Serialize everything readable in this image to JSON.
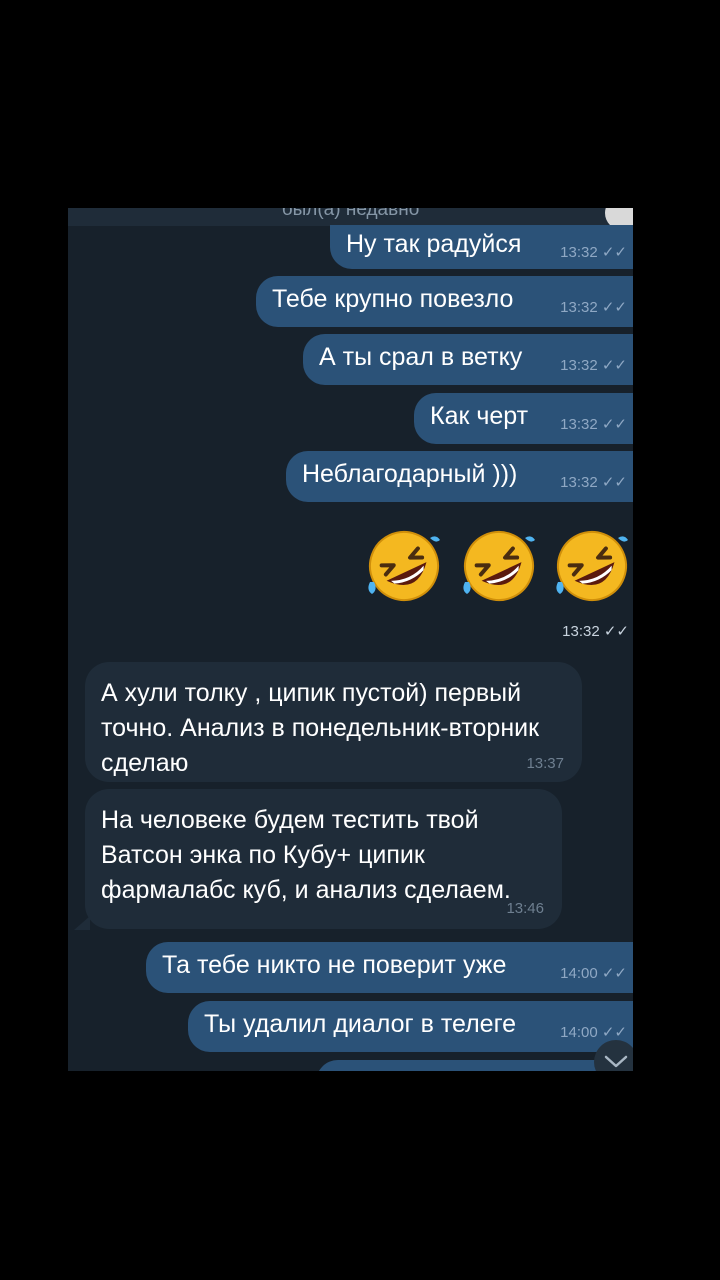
{
  "header": {
    "status": "был(а) недавно"
  },
  "messages_out_top": [
    {
      "text": "Ну так радуйся",
      "time": "13:32"
    },
    {
      "text": "Тебе крупно повезло",
      "time": "13:32"
    },
    {
      "text": "А ты срал в ветку",
      "time": "13:32"
    },
    {
      "text": "Как черт",
      "time": "13:32"
    },
    {
      "text": "Неблагодарный )))",
      "time": "13:32"
    }
  ],
  "sticker": {
    "emoji": "rolling-on-floor-laughing",
    "count": 3,
    "time": "13:32"
  },
  "messages_in": [
    {
      "text": "А хули толку , ципик пустой) первый точно. Анализ в понедельник-вторник сделаю",
      "time": "13:37"
    },
    {
      "text": "На человеке будем тестить твой Ватсон энка по Кубу+ ципик фармалабс куб, и анализ сделаем.",
      "time": "13:46"
    }
  ],
  "messages_out_bottom": [
    {
      "text": "Та тебе никто не поверит уже",
      "time": "14:00"
    },
    {
      "text": "Ты удалил диалог в телеге",
      "time": "14:00"
    }
  ],
  "colors": {
    "bg": "#17212b",
    "outgoing": "#2b5278",
    "incoming": "#1f2c39"
  }
}
